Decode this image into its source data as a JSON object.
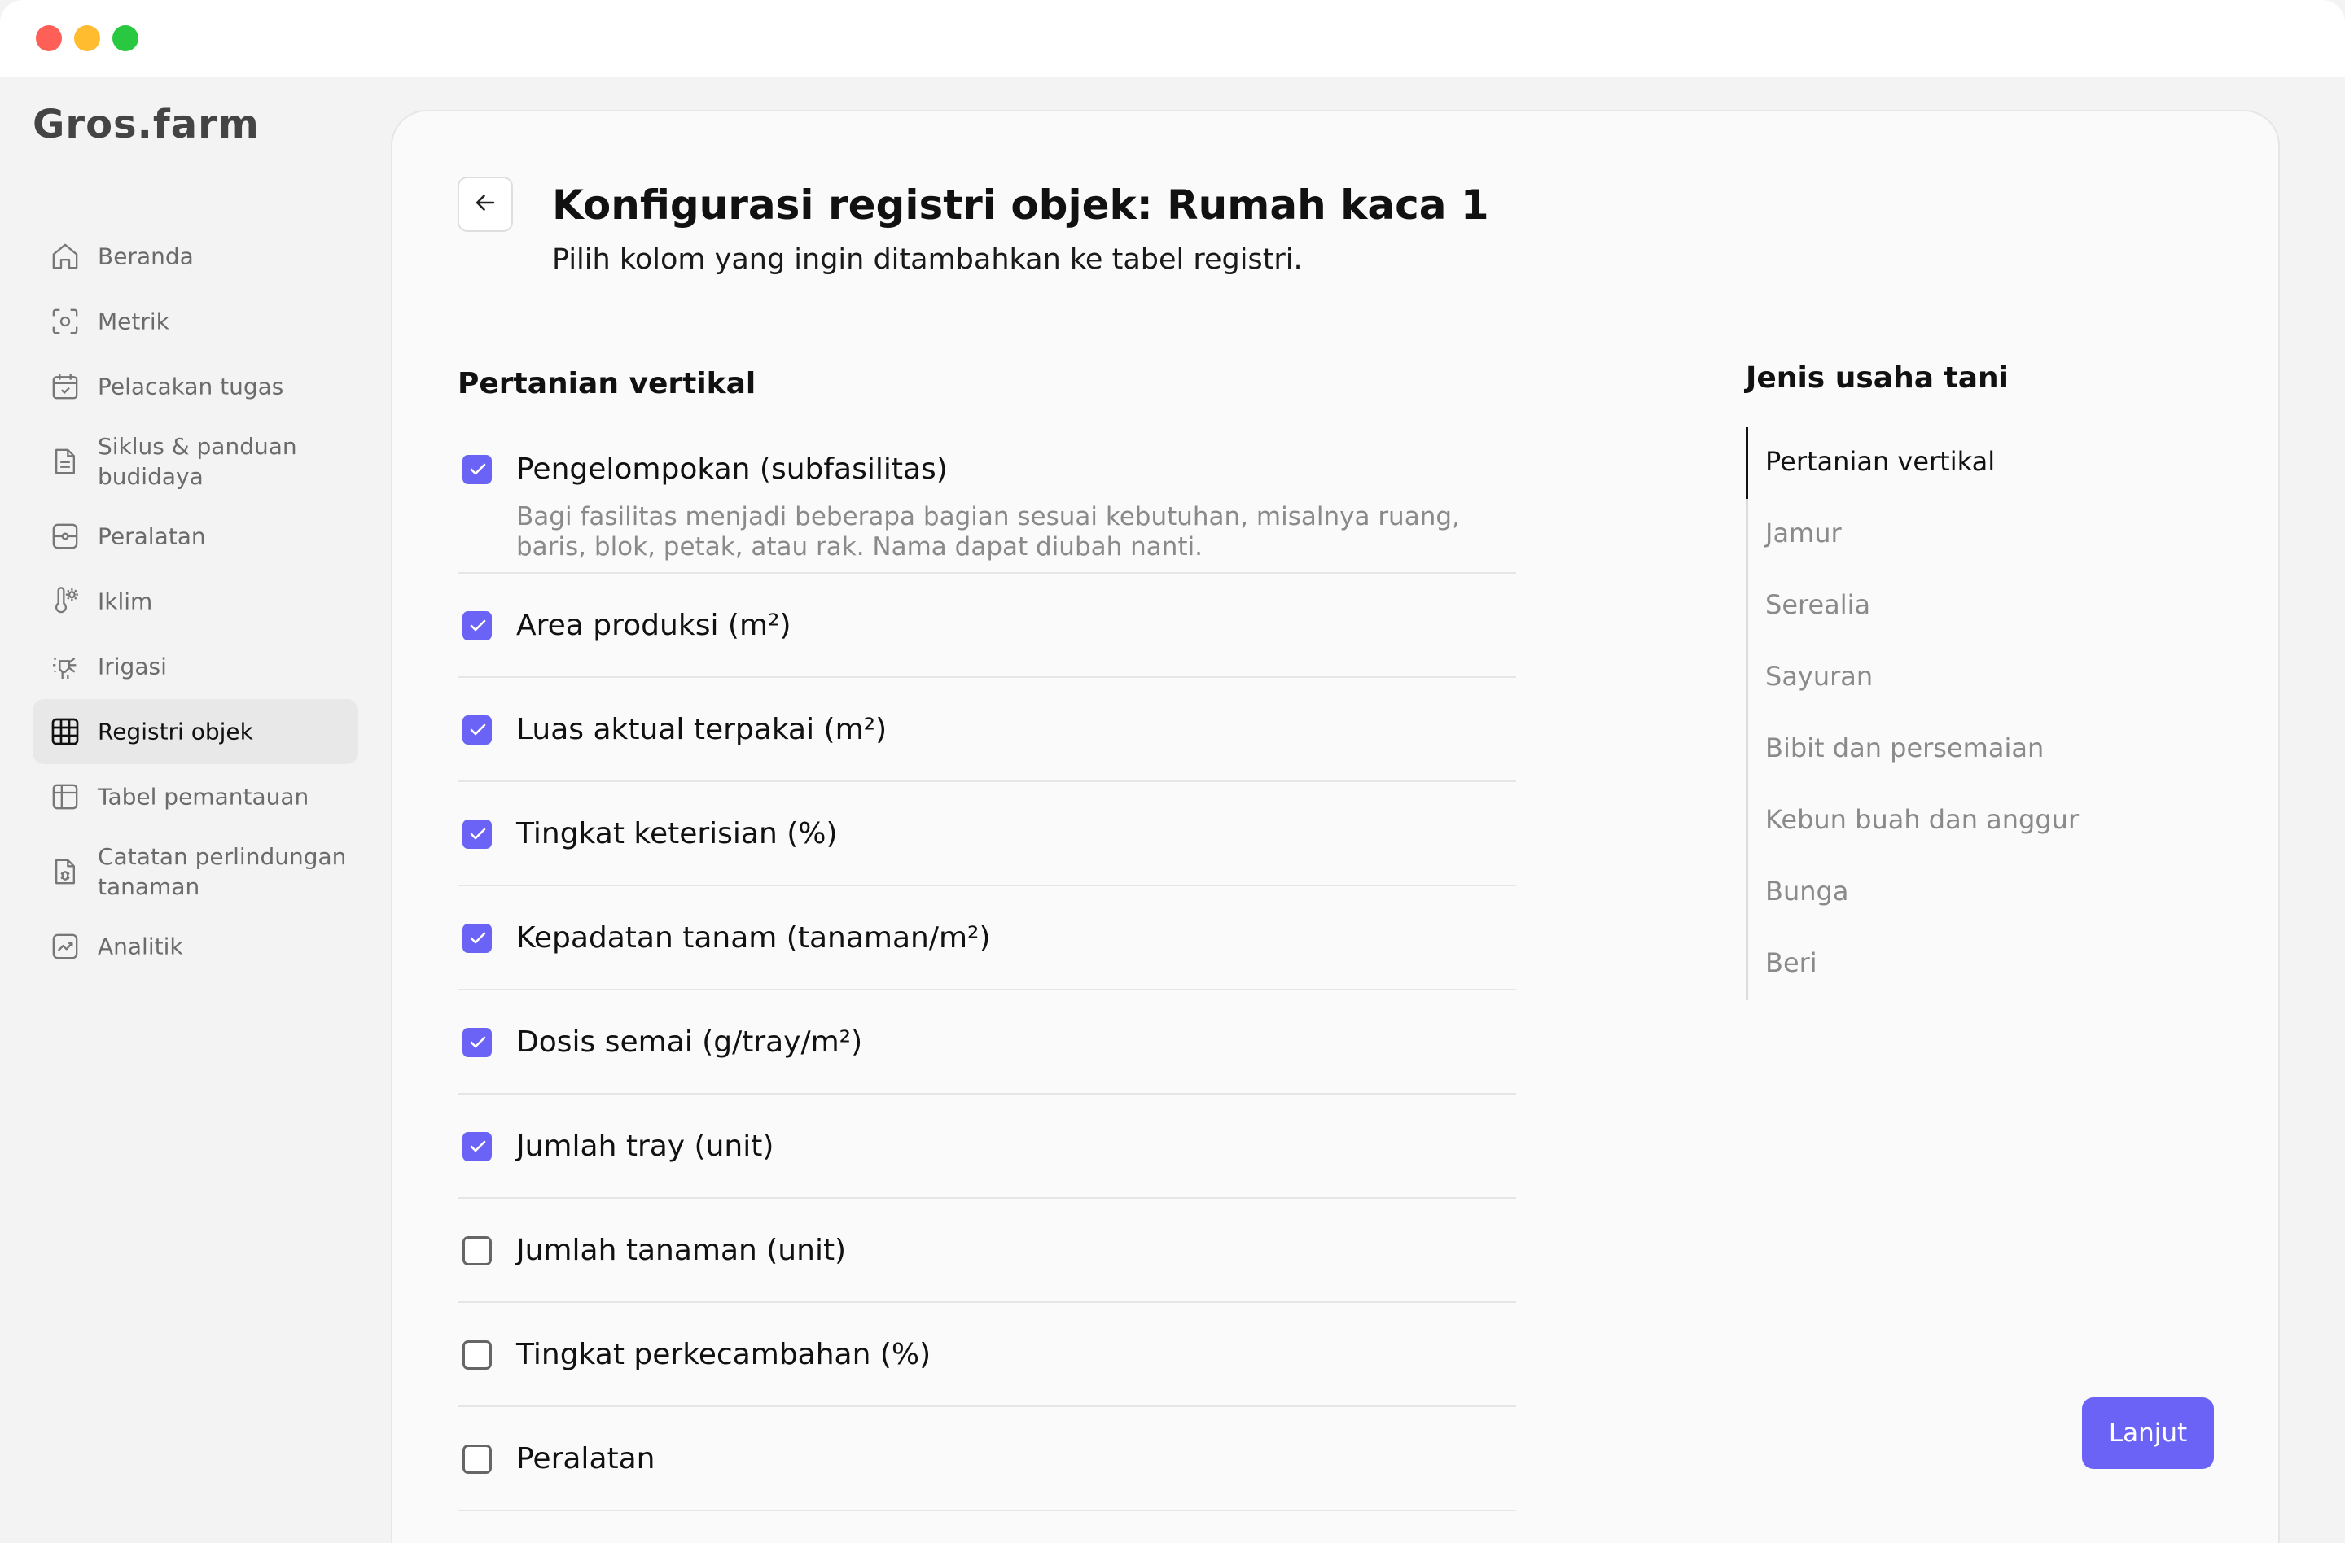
{
  "app": {
    "logo": "Gros.farm"
  },
  "sidebar": {
    "items": [
      {
        "label": "Beranda",
        "icon": "home-icon"
      },
      {
        "label": "Metrik",
        "icon": "metrics-icon"
      },
      {
        "label": "Pelacakan tugas",
        "icon": "calendar-check-icon"
      },
      {
        "label": "Siklus & panduan budidaya",
        "icon": "document-icon"
      },
      {
        "label": "Peralatan",
        "icon": "equipment-icon"
      },
      {
        "label": "Iklim",
        "icon": "thermometer-sun-icon"
      },
      {
        "label": "Irigasi",
        "icon": "sprinkler-icon"
      },
      {
        "label": "Registri objek",
        "icon": "grid-icon",
        "active": true
      },
      {
        "label": "Tabel pemantauan",
        "icon": "table-icon"
      },
      {
        "label": "Catatan perlindungan tanaman",
        "icon": "bug-document-icon"
      },
      {
        "label": "Analitik",
        "icon": "chart-trend-icon"
      }
    ]
  },
  "header": {
    "title": "Konfigurasi registri objek: Rumah kaca 1",
    "subtitle": "Pilih kolom yang ingin ditambahkan ke tabel registri.",
    "back_icon": "arrow-left-icon"
  },
  "section": {
    "title": "Pertanian vertikal",
    "options": [
      {
        "label": "Pengelompokan (subfasilitas)",
        "checked": true,
        "description": "Bagi fasilitas menjadi beberapa bagian sesuai kebutuhan, misalnya ruang, baris, blok, petak, atau rak. Nama dapat diubah nanti."
      },
      {
        "label": "Area produksi (m²)",
        "checked": true
      },
      {
        "label": "Luas aktual terpakai (m²)",
        "checked": true
      },
      {
        "label": "Tingkat keterisian (%)",
        "checked": true
      },
      {
        "label": "Kepadatan tanam (tanaman/m²)",
        "checked": true
      },
      {
        "label": "Dosis semai (g/tray/m²)",
        "checked": true
      },
      {
        "label": "Jumlah tray (unit)",
        "checked": true
      },
      {
        "label": "Jumlah tanaman (unit)",
        "checked": false
      },
      {
        "label": "Tingkat perkecambahan (%)",
        "checked": false
      },
      {
        "label": "Peralatan",
        "checked": false
      }
    ]
  },
  "farm_types": {
    "title": "Jenis usaha tani",
    "items": [
      {
        "label": "Pertanian vertikal",
        "active": true
      },
      {
        "label": "Jamur"
      },
      {
        "label": "Serealia"
      },
      {
        "label": "Sayuran"
      },
      {
        "label": "Bibit dan persemaian"
      },
      {
        "label": "Kebun buah dan anggur"
      },
      {
        "label": "Bunga"
      },
      {
        "label": "Beri"
      }
    ]
  },
  "actions": {
    "next_label": "Lanjut"
  },
  "colors": {
    "accent": "#6a63f6",
    "checkbox_checked": "#6a63f6",
    "active_nav_bg": "#e8e8e8"
  }
}
